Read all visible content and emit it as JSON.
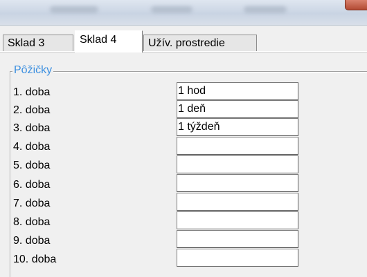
{
  "tabs": [
    {
      "label": "Sklad 3",
      "active": false
    },
    {
      "label": "Sklad 4",
      "active": true
    },
    {
      "label": "Užív. prostredie",
      "active": false
    }
  ],
  "group": {
    "title": "Pôžičky",
    "rows": [
      {
        "label": "1. doba",
        "value": "1 hod"
      },
      {
        "label": "2. doba",
        "value": "1 deň"
      },
      {
        "label": "3. doba",
        "value": "1 týždeň"
      },
      {
        "label": "4. doba",
        "value": ""
      },
      {
        "label": "5. doba",
        "value": ""
      },
      {
        "label": "6. doba",
        "value": ""
      },
      {
        "label": "7. doba",
        "value": ""
      },
      {
        "label": "8. doba",
        "value": ""
      },
      {
        "label": "9. doba",
        "value": ""
      },
      {
        "label": "10. doba",
        "value": ""
      }
    ]
  },
  "colors": {
    "legend": "#3b8fe0",
    "close_button": "#c0503a"
  }
}
